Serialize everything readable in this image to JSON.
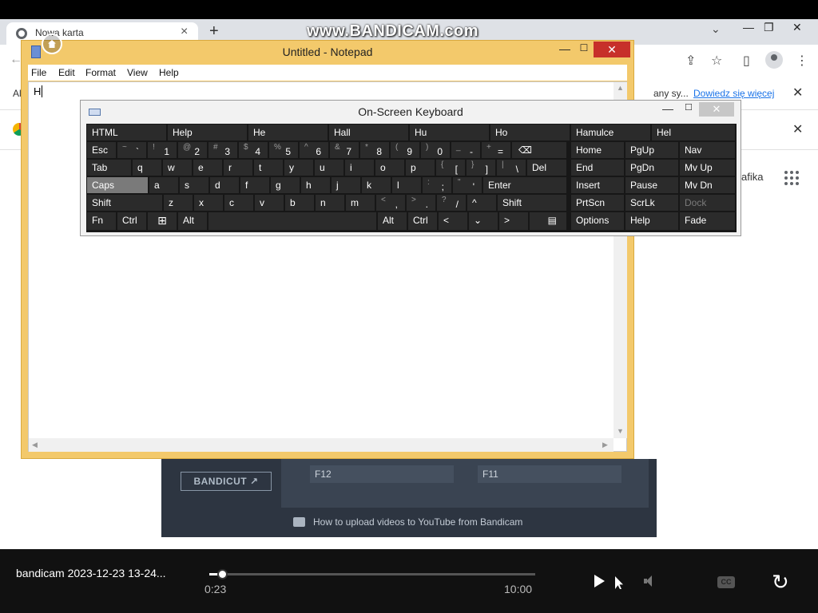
{
  "chrome": {
    "tab_title": "Nowa karta",
    "tab_close": "×",
    "new_tab": "+",
    "tab_search": "⌄",
    "minimize": "—",
    "restore": "❐",
    "close": "✕",
    "info_bar": {
      "cut_text": "Al",
      "message": "any sy...",
      "link": "Dowiedz się więcej",
      "close": "✕"
    },
    "promo_close": "✕",
    "grafika": "afika",
    "toolbar": {
      "back": "←",
      "share": "⇪",
      "star": "☆",
      "sidepanel": "▯",
      "menu": "⋮"
    }
  },
  "watermark": "www.BANDICAM.com",
  "notepad": {
    "title": "Untitled - Notepad",
    "minimize": "—",
    "maximize": "☐",
    "close": "✕",
    "menu": [
      "File",
      "Edit",
      "Format",
      "View",
      "Help"
    ],
    "text": "H"
  },
  "osk": {
    "title": "On-Screen Keyboard",
    "minimize": "—",
    "maximize": "☐",
    "close": "✕",
    "row_predict": [
      "HTML",
      "Help",
      "He",
      "Hall",
      "Hu",
      "Ho",
      "Hamulce",
      "Hel"
    ],
    "row1": {
      "esc": "Esc",
      "pairs": [
        [
          "~",
          "`"
        ],
        [
          "!",
          "1"
        ],
        [
          "@",
          "2"
        ],
        [
          "#",
          "3"
        ],
        [
          "$",
          "4"
        ],
        [
          "%",
          "5"
        ],
        [
          "^",
          "6"
        ],
        [
          "&",
          "7"
        ],
        [
          "*",
          "8"
        ],
        [
          "(",
          "9"
        ],
        [
          ")",
          "0"
        ],
        [
          "_",
          "-"
        ],
        [
          "+",
          "="
        ]
      ],
      "backspace": "⌫"
    },
    "row2": {
      "tab": "Tab",
      "letters": [
        "q",
        "w",
        "e",
        "r",
        "t",
        "y",
        "u",
        "i",
        "o",
        "p"
      ],
      "pairs": [
        [
          "{",
          "["
        ],
        [
          "}",
          "]"
        ],
        [
          "|",
          "\\"
        ]
      ],
      "del": "Del"
    },
    "row3": {
      "caps": "Caps",
      "letters": [
        "a",
        "s",
        "d",
        "f",
        "g",
        "h",
        "j",
        "k",
        "l"
      ],
      "pairs": [
        [
          ":",
          ";"
        ],
        [
          "\"",
          "'"
        ]
      ],
      "enter": "Enter"
    },
    "row4": {
      "shift": "Shift",
      "letters": [
        "z",
        "x",
        "c",
        "v",
        "b",
        "n",
        "m"
      ],
      "pairs": [
        [
          "<",
          ","
        ],
        [
          ">",
          "."
        ],
        [
          "?",
          "/"
        ]
      ],
      "up": "^",
      "shift_right": "Shift"
    },
    "row5": {
      "fn": "Fn",
      "ctrl": "Ctrl",
      "win": "⊞",
      "alt": "Alt",
      "alt_right": "Alt",
      "ctrl_right": "Ctrl",
      "left": "<",
      "down": "⌄",
      "right": ">",
      "menu": "▤"
    },
    "nav": [
      [
        "Home",
        "PgUp",
        "Nav"
      ],
      [
        "End",
        "PgDn",
        "Mv Up"
      ],
      [
        "Insert",
        "Pause",
        "Mv Dn"
      ],
      [
        "PrtScn",
        "ScrLk",
        "Dock"
      ],
      [
        "Options",
        "Help",
        "Fade"
      ]
    ]
  },
  "bandicam": {
    "bandicut": "BANDICUT ↗",
    "f12": "F12",
    "f11": "F11",
    "tip": "How to upload videos to YouTube from Bandicam"
  },
  "player": {
    "title": "bandicam 2023-12-23 13-24...",
    "current": "0:23",
    "total": "10:00",
    "progress_percent": 3.8,
    "cc": "CC",
    "replay": "↻"
  }
}
